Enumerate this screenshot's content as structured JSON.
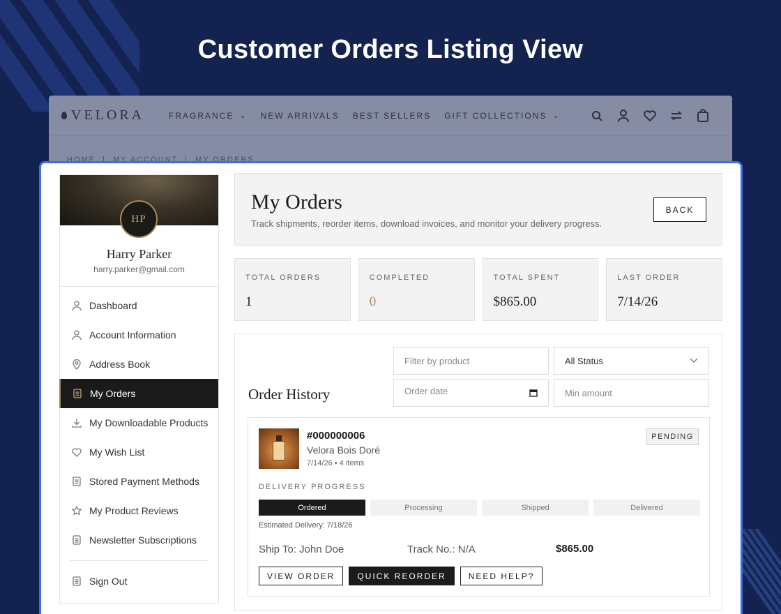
{
  "headline": "Customer Orders Listing View",
  "site": {
    "logo": "VELORA",
    "nav": [
      {
        "label": "FRAGRANCE",
        "has_dropdown": true
      },
      {
        "label": "NEW ARRIVALS",
        "has_dropdown": false
      },
      {
        "label": "BEST SELLERS",
        "has_dropdown": false
      },
      {
        "label": "GIFT COLLECTIONS",
        "has_dropdown": true
      }
    ],
    "icons": [
      "search-icon",
      "user-icon",
      "heart-icon",
      "compare-icon",
      "cart-icon"
    ],
    "breadcrumb": [
      "HOME",
      "MY ACCOUNT",
      "MY ORDERS"
    ]
  },
  "user": {
    "initials": "HP",
    "name": "Harry Parker",
    "email": "harry.parker@gmail.com"
  },
  "menu": [
    {
      "label": "Dashboard",
      "icon": "user-icon",
      "active": false
    },
    {
      "label": "Account Information",
      "icon": "user-icon",
      "active": false
    },
    {
      "label": "Address Book",
      "icon": "location-icon",
      "active": false
    },
    {
      "label": "My Orders",
      "icon": "document-icon",
      "active": true
    },
    {
      "label": "My Downloadable Products",
      "icon": "download-icon",
      "active": false
    },
    {
      "label": "My Wish List",
      "icon": "heart-icon",
      "active": false
    },
    {
      "label": "Stored Payment Methods",
      "icon": "document-icon",
      "active": false
    },
    {
      "label": "My Product Reviews",
      "icon": "star-icon",
      "active": false
    },
    {
      "label": "Newsletter Subscriptions",
      "icon": "document-icon",
      "active": false
    }
  ],
  "sign_out": "Sign Out",
  "page": {
    "title": "My Orders",
    "subtitle": "Track shipments, reorder items, download invoices, and monitor your delivery progress.",
    "back_label": "BACK"
  },
  "stats": [
    {
      "label": "TOTAL ORDERS",
      "value": "1"
    },
    {
      "label": "COMPLETED",
      "value": "0"
    },
    {
      "label": "TOTAL SPENT",
      "value": "$865.00"
    },
    {
      "label": "LAST ORDER",
      "value": "7/14/26"
    }
  ],
  "history": {
    "title": "Order History",
    "filter_product_placeholder": "Filter by product",
    "status_value": "All Status",
    "order_date_placeholder": "Order date",
    "min_amount_placeholder": "Min amount"
  },
  "order": {
    "id": "#000000006",
    "product": "Velora Bois Doré",
    "meta": "7/14/26 • 4 items",
    "status": "PENDING",
    "delivery_label": "DELIVERY PROGRESS",
    "steps": [
      {
        "label": "Ordered",
        "done": true
      },
      {
        "label": "Processing",
        "done": false
      },
      {
        "label": "Shipped",
        "done": false
      },
      {
        "label": "Delivered",
        "done": false
      }
    ],
    "estimated": "Estimated Delivery: 7/18/26",
    "ship_to": "Ship To: John Doe",
    "track": "Track No.: N/A",
    "total": "$865.00",
    "buttons": {
      "view": "VIEW ORDER",
      "reorder": "QUICK REORDER",
      "help": "NEED HELP?"
    }
  },
  "colors": {
    "background": "#13224f",
    "accent_gold": "#a68a56",
    "panel_border": "#3d6ee8",
    "dark": "#1b1b1b"
  }
}
